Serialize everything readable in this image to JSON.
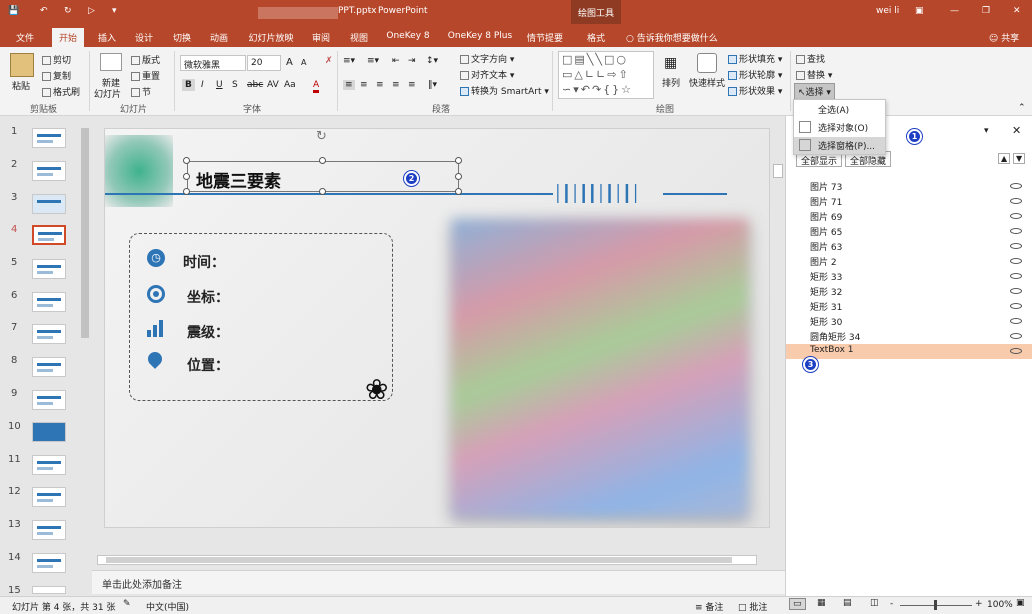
{
  "title_bar": {
    "filename": "PPT.pptx",
    "separator": "-",
    "app": "PowerPoint",
    "context_tab_group": "绘图工具",
    "user": "wei li",
    "share": "共享",
    "tell_me": "告诉我你想要做什么"
  },
  "tabs": [
    "文件",
    "开始",
    "插入",
    "设计",
    "切换",
    "动画",
    "幻灯片放映",
    "审阅",
    "视图",
    "OneKey 8",
    "OneKey 8 Plus",
    "情节提要",
    "格式"
  ],
  "ribbon": {
    "clipboard": {
      "paste": "粘贴",
      "cut": "剪切",
      "copy": "复制",
      "format_painter": "格式刷",
      "label": "剪贴板"
    },
    "slides": {
      "new_slide_line1": "新建",
      "new_slide_line2": "幻灯片",
      "layout": "版式",
      "reset": "重置",
      "section": "节",
      "label": "幻灯片"
    },
    "font": {
      "font_name": "微软雅黑",
      "font_size": "20",
      "bold": "B",
      "italic": "I",
      "underline": "U",
      "strike": "S",
      "shadow": "abc",
      "spacing": "AV",
      "case": "Aa",
      "grow": "A",
      "shrink": "A",
      "color": "A",
      "label": "字体"
    },
    "paragraph": {
      "text_direction": "文字方向",
      "align_text": "对齐文本",
      "smartart": "转换为 SmartArt",
      "label": "段落"
    },
    "drawing": {
      "arrange": "排列",
      "quick_styles": "快速样式",
      "shape_fill": "形状填充",
      "shape_outline": "形状轮廓",
      "shape_effects": "形状效果",
      "label": "绘图"
    },
    "editing": {
      "find": "查找",
      "replace": "替换",
      "select": "选择"
    }
  },
  "select_menu": {
    "select_all": "全选(A)",
    "select_objects": "选择对象(O)",
    "selection_pane": "选择窗格(P)..."
  },
  "thumbnails": [
    "1",
    "2",
    "3",
    "4",
    "5",
    "6",
    "7",
    "8",
    "9",
    "10",
    "11",
    "12",
    "13",
    "14",
    "15"
  ],
  "active_slide": "4",
  "slide": {
    "title": "地震三要素",
    "items": [
      "时间：",
      "坐标：",
      "震级：",
      "位置："
    ]
  },
  "notes_placeholder": "单击此处添加备注",
  "selection_pane": {
    "show_all": "全部显示",
    "hide_all": "全部隐藏",
    "layers": [
      "图片 73",
      "图片 71",
      "图片 69",
      "图片 65",
      "图片 63",
      "图片 2",
      "矩形 33",
      "矩形 32",
      "矩形 31",
      "矩形 30",
      "圆角矩形 34",
      "TextBox 1"
    ],
    "selected_index": 11
  },
  "badges": [
    "1",
    "2",
    "3"
  ],
  "status": {
    "slide_count": "幻灯片 第 4 张，共 31 张",
    "language": "中文(中国)",
    "notes": "备注",
    "comments": "批注",
    "zoom": "100%",
    "zoom_minus": "-",
    "zoom_plus": "+"
  },
  "colors": {
    "accent": "#b7472a",
    "selected_layer": "#f8cbad",
    "slide_line": "#2e75b6"
  }
}
